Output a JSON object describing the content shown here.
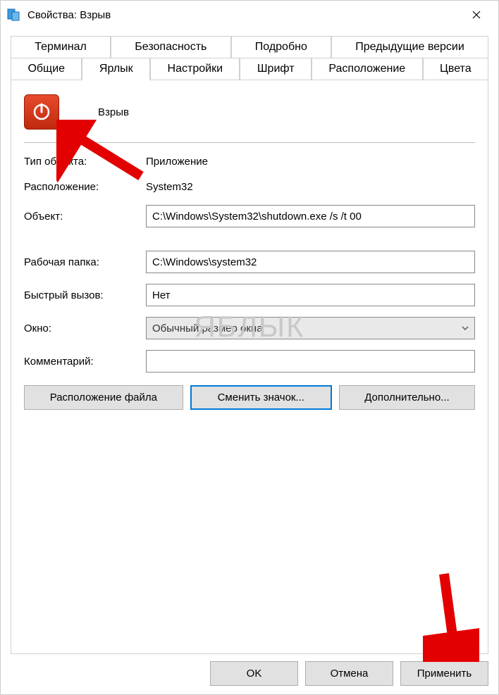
{
  "window": {
    "title": "Свойства: Взрыв"
  },
  "tabs": {
    "row1": [
      "Терминал",
      "Безопасность",
      "Подробно",
      "Предыдущие версии"
    ],
    "row2": [
      "Общие",
      "Ярлык",
      "Настройки",
      "Шрифт",
      "Расположение",
      "Цвета"
    ],
    "active": "Ярлык"
  },
  "shortcut": {
    "name": "Взрыв"
  },
  "fields": {
    "type_label": "Тип объекта:",
    "type_value": "Приложение",
    "location_label": "Расположение:",
    "location_value": "System32",
    "target_label": "Объект:",
    "target_value": "C:\\Windows\\System32\\shutdown.exe /s /t 00",
    "workdir_label": "Рабочая папка:",
    "workdir_value": "C:\\Windows\\system32",
    "hotkey_label": "Быстрый вызов:",
    "hotkey_value": "Нет",
    "run_label": "Окно:",
    "run_value": "Обычный размер окна",
    "comment_label": "Комментарий:",
    "comment_value": ""
  },
  "buttons": {
    "open_location": "Расположение файла",
    "change_icon": "Сменить значок...",
    "advanced": "Дополнительно...",
    "ok": "OK",
    "cancel": "Отмена",
    "apply": "Применить"
  },
  "watermark": "ЯБЛЫК"
}
